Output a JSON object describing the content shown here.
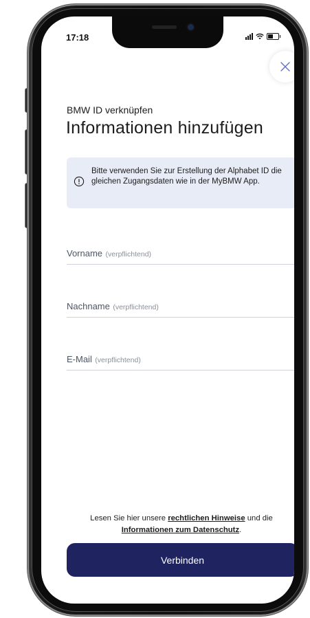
{
  "status_bar": {
    "time": "17:18"
  },
  "header": {
    "subtitle": "BMW ID verknüpfen",
    "title": "Informationen hinzufügen",
    "close_icon": "close-x"
  },
  "info_box": {
    "icon": "info-circle",
    "text": "Bitte verwenden Sie zur Erstellung der Alphabet ID die gleichen Zugangsdaten wie in der MyBMW App."
  },
  "form": {
    "fields": [
      {
        "label": "Vorname",
        "hint": "(verpflichtend)",
        "value": ""
      },
      {
        "label": "Nachname",
        "hint": "(verpflichtend)",
        "value": ""
      },
      {
        "label": "E-Mail",
        "hint": "(verpflichtend)",
        "value": ""
      }
    ]
  },
  "legal": {
    "prefix": "Lesen Sie hier unsere ",
    "link_legal": "rechtlichen Hinweise",
    "middle": " und die",
    "link_privacy": "Informationen zum Datenschutz",
    "suffix": "."
  },
  "cta": {
    "label": "Verbinden"
  },
  "colors": {
    "primary": "#1f2460",
    "info_bg": "#e8ecf7",
    "close_icon": "#5b6fc8"
  }
}
